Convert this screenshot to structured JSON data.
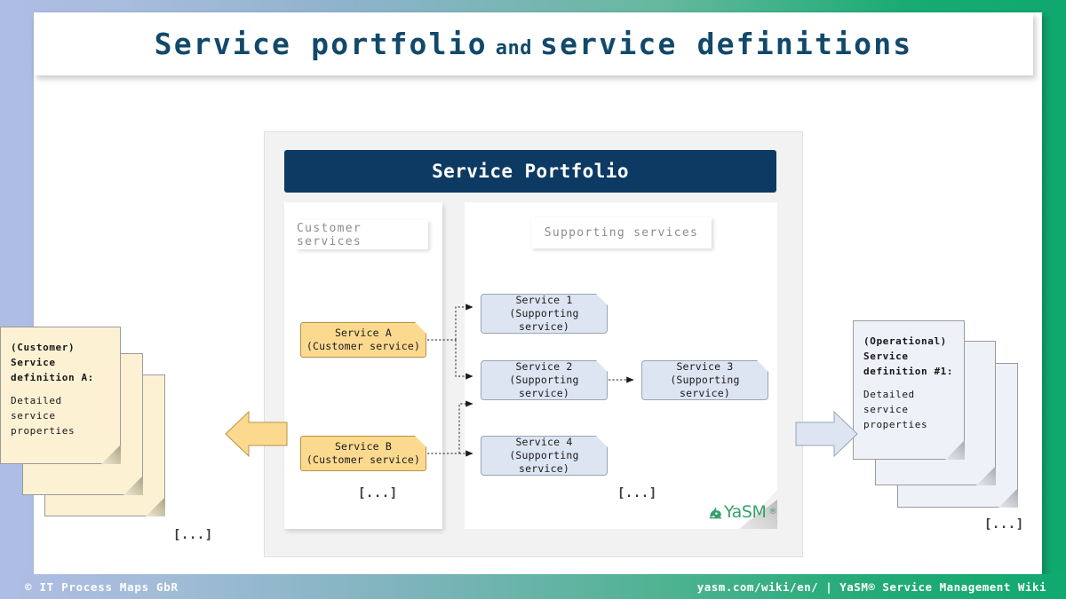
{
  "title": {
    "main_part_1": "Service portfolio",
    "connector_word": "and",
    "main_part_2": "service definitions"
  },
  "colors": {
    "title_text": "#12496b",
    "portfolio_header_bg": "#0d3a62",
    "customer_service_box": "#fbd98f",
    "supporting_service_box": "#dde5f2",
    "customer_doc_sheet": "#fdf1d4",
    "operational_doc_sheet": "#eef1f7",
    "brand_green": "#10a86f",
    "brand_blue": "#aebde4",
    "yasm_logo_green": "#37a06d"
  },
  "diagram": {
    "portfolio_header": "Service Portfolio",
    "sections": {
      "customer": {
        "label": "Customer services",
        "ellipsis": "[...]",
        "nodes": [
          {
            "id": "service-a",
            "name": "Service A",
            "kind": "(Customer service)"
          },
          {
            "id": "service-b",
            "name": "Service B",
            "kind": "(Customer service)"
          }
        ]
      },
      "supporting": {
        "label": "Supporting services",
        "ellipsis": "[...]",
        "nodes": [
          {
            "id": "service-1",
            "name": "Service 1",
            "kind": "(Supporting service)"
          },
          {
            "id": "service-2",
            "name": "Service 2",
            "kind": "(Supporting service)"
          },
          {
            "id": "service-3",
            "name": "Service 3",
            "kind": "(Supporting service)"
          },
          {
            "id": "service-4",
            "name": "Service 4",
            "kind": "(Supporting service)"
          }
        ]
      }
    },
    "logo": {
      "wordmark": "YaSM",
      "registered": "®"
    }
  },
  "left_stack": {
    "header": "(Customer)\nService\ndefinition A:",
    "body": "Detailed\nservice\nproperties",
    "ellipsis": "[...]"
  },
  "right_stack": {
    "header": "(Operational)\nService\ndefinition #1:",
    "body": "Detailed\nservice\nproperties",
    "ellipsis": "[...]"
  },
  "footer": {
    "left": "© IT Process Maps GbR",
    "right": "yasm.com/wiki/en/ | YaSM® Service Management Wiki"
  }
}
